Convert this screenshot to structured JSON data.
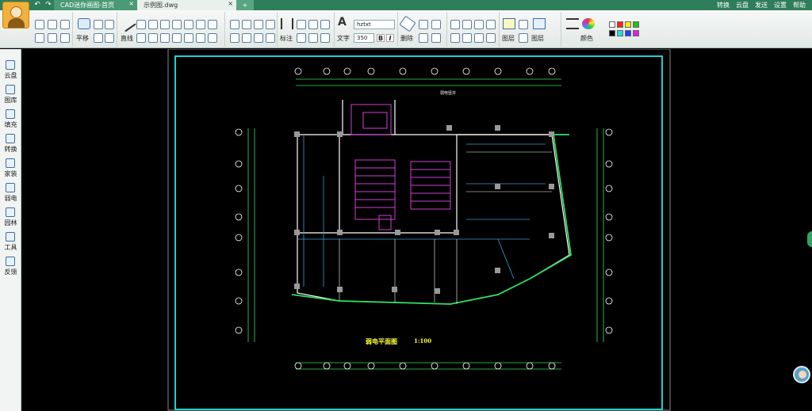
{
  "window": {
    "tabs": [
      {
        "label": "CAD迷你画图-首页",
        "active": false
      },
      {
        "label": "示例图.dwg",
        "active": true
      }
    ],
    "new_tab_label": "+",
    "close_symbol": "×",
    "right_menu": [
      "转换",
      "云盘",
      "发送",
      "设置",
      "帮助"
    ]
  },
  "ribbon": {
    "labels": {
      "pan": "平移",
      "line": "直线",
      "dim": "标注",
      "text": "文字",
      "erase": "删除",
      "layer": "图层",
      "props": "图层",
      "color": "颜色"
    },
    "text_style": "hztxt",
    "text_size": "350",
    "bold": "B",
    "italic": "I"
  },
  "sidebar": {
    "items": [
      {
        "label": "云盘",
        "icon": "cloud-icon"
      },
      {
        "label": "图库",
        "icon": "library-icon"
      },
      {
        "label": "填充",
        "icon": "hatch-icon"
      },
      {
        "label": "转换",
        "icon": "convert-icon"
      },
      {
        "label": "家装",
        "icon": "decor-icon"
      },
      {
        "label": "弱电",
        "icon": "weak-current-icon"
      },
      {
        "label": "园林",
        "icon": "garden-icon"
      },
      {
        "label": "工具",
        "icon": "tools-icon"
      },
      {
        "label": "反馈",
        "icon": "feedback-icon"
      }
    ]
  },
  "drawing": {
    "title": "弱电平面图",
    "scale": "1:100"
  },
  "colors": {
    "titlebar": "#2e7d5b",
    "frame": "#20d0d0",
    "wall": "#ffffff",
    "accent_green": "#30e060",
    "magenta": "#d040d0"
  }
}
